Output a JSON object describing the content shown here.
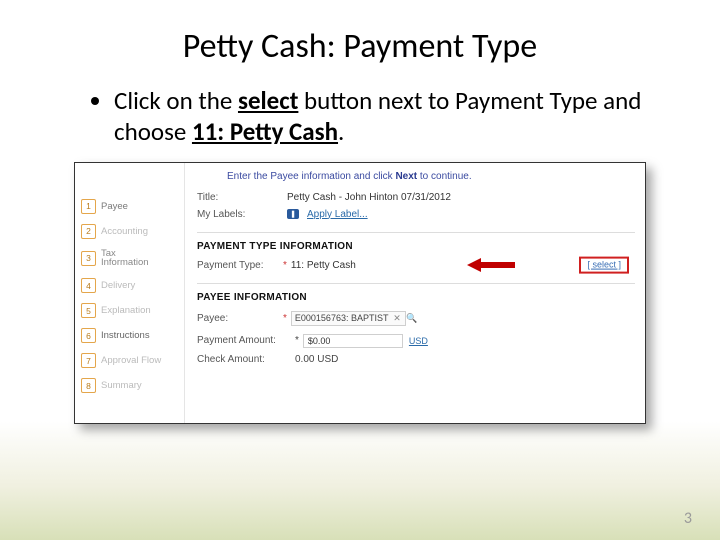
{
  "slide": {
    "title": "Petty Cash: Payment Type",
    "page_number": "3",
    "bullet": {
      "pre": "Click on the ",
      "select_word": "select",
      "mid": " button next to Payment Type and choose ",
      "choice": "11: Petty Cash",
      "post": "."
    }
  },
  "screenshot": {
    "instruction_pre": "Enter the Payee information and click ",
    "instruction_bold": "Next",
    "instruction_post": " to continue.",
    "steps": [
      {
        "n": "1",
        "label": "Payee"
      },
      {
        "n": "2",
        "label": "Accounting"
      },
      {
        "n": "3",
        "label": "Tax\nInformation"
      },
      {
        "n": "4",
        "label": "Delivery"
      },
      {
        "n": "5",
        "label": "Explanation"
      },
      {
        "n": "6",
        "label": "Instructions"
      },
      {
        "n": "7",
        "label": "Approval Flow"
      },
      {
        "n": "8",
        "label": "Summary"
      }
    ],
    "title_label": "Title:",
    "title_value": "Petty Cash - John Hinton 07/31/2012",
    "mylabels_label": "My Labels:",
    "mylabels_link": "Apply Label...",
    "section_payment": "PAYMENT TYPE INFORMATION",
    "payment_type_label": "Payment Type:",
    "asterisk": "*",
    "payment_type_value": "11: Petty Cash",
    "select_button": "[ select ]",
    "section_payee": "PAYEE INFORMATION",
    "payee_label": "Payee:",
    "payee_value": "E000156763: BAPTIST",
    "payment_amount_label": "Payment Amount:",
    "payment_amount_value": "$0.00",
    "currency": "USD",
    "check_amount_label": "Check Amount:",
    "check_amount_value": "0.00 USD"
  }
}
